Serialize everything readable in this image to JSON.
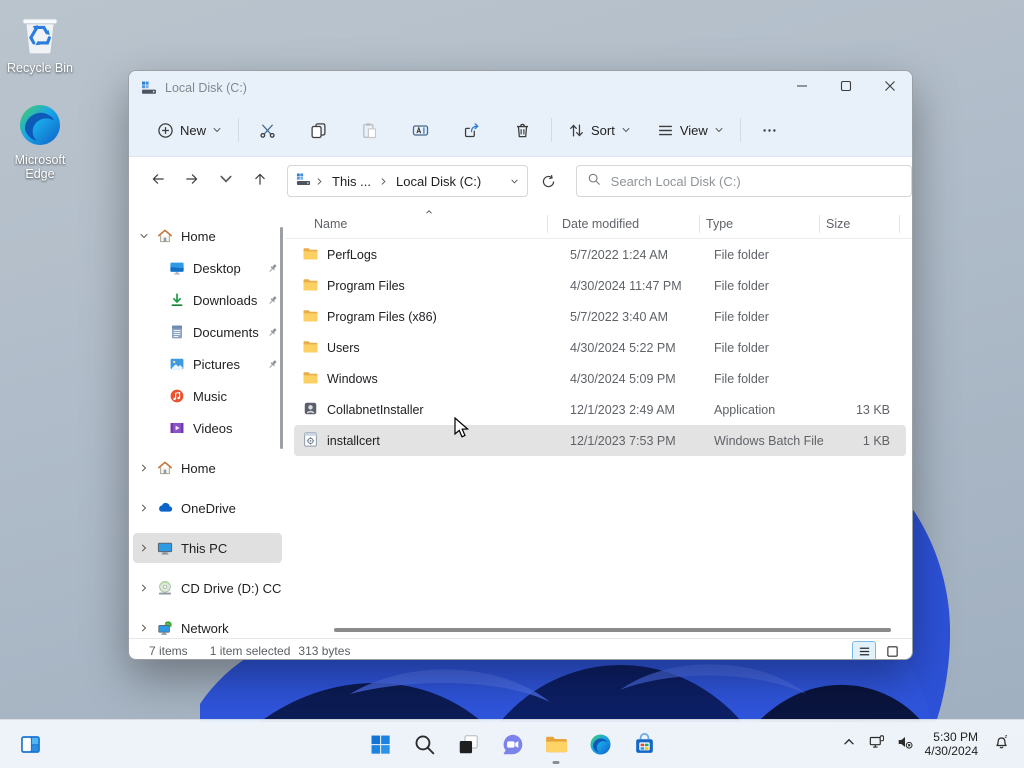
{
  "desktop": {
    "icons": [
      {
        "name": "recycle-bin",
        "icon": "recycle-bin-icon",
        "label": "Recycle Bin"
      },
      {
        "name": "microsoft-edge",
        "icon": "edge-icon",
        "label": "Microsoft Edge"
      }
    ]
  },
  "window": {
    "title": "Local Disk (C:)",
    "title_icon": "drive-icon",
    "controls": [
      {
        "name": "minimize-button",
        "icon": "minimize-icon"
      },
      {
        "name": "maximize-button",
        "icon": "maximize-icon"
      },
      {
        "name": "close-button",
        "icon": "close-icon"
      }
    ],
    "toolbar": {
      "new_label": "New",
      "buttons": [
        {
          "name": "cut-button",
          "icon": "cut-icon"
        },
        {
          "name": "copy-button",
          "icon": "copy-icon"
        },
        {
          "name": "paste-button",
          "icon": "paste-icon"
        },
        {
          "name": "rename-button",
          "icon": "rename-icon"
        },
        {
          "name": "share-button",
          "icon": "share-icon"
        },
        {
          "name": "delete-button",
          "icon": "delete-icon"
        }
      ],
      "sort_label": "Sort",
      "view_label": "View"
    },
    "nav": [
      {
        "name": "back-button",
        "icon": "back-icon"
      },
      {
        "name": "forward-button",
        "icon": "forward-icon"
      },
      {
        "name": "recent-locations-button",
        "icon": "chevron-down-icon"
      },
      {
        "name": "up-button",
        "icon": "up-icon"
      }
    ],
    "addressbar": {
      "icon": "drive-icon",
      "crumbs": [
        "This ...",
        "Local Disk (C:)"
      ]
    },
    "search": {
      "placeholder": "Search Local Disk (C:)"
    },
    "sidebar": [
      {
        "label": "Home",
        "icon": "home-icon",
        "chevron": "down",
        "indent": 0
      },
      {
        "label": "Desktop",
        "icon": "desktop-icon",
        "indent": 1,
        "pinned": true
      },
      {
        "label": "Downloads",
        "icon": "downloads-icon",
        "indent": 1,
        "pinned": true
      },
      {
        "label": "Documents",
        "icon": "documents-icon",
        "indent": 1,
        "pinned": true
      },
      {
        "label": "Pictures",
        "icon": "pictures-icon",
        "indent": 1,
        "pinned": true
      },
      {
        "label": "Music",
        "icon": "music-icon",
        "indent": 1
      },
      {
        "label": "Videos",
        "icon": "videos-icon",
        "indent": 1
      },
      {
        "label": "Home",
        "icon": "home-icon",
        "chevron": "right",
        "indent": 0,
        "gap": true
      },
      {
        "label": "OneDrive",
        "icon": "onedrive-icon",
        "chevron": "right",
        "indent": 0,
        "gap": true
      },
      {
        "label": "This PC",
        "icon": "this-pc-icon",
        "chevron": "right",
        "indent": 0,
        "gap": true,
        "selected": true
      },
      {
        "label": "CD Drive (D:) CC",
        "icon": "cd-drive-icon",
        "chevron": "right",
        "indent": 0,
        "gap": true
      },
      {
        "label": "Network",
        "icon": "network-places-icon",
        "chevron": "right",
        "indent": 0,
        "gap": true
      }
    ],
    "files": {
      "columns": [
        "Name",
        "Date modified",
        "Type",
        "Size"
      ],
      "sort_indicator": "ascending",
      "rows": [
        {
          "name": "PerfLogs",
          "icon": "folder-icon",
          "date": "5/7/2022 1:24 AM",
          "type": "File folder",
          "size": ""
        },
        {
          "name": "Program Files",
          "icon": "folder-icon",
          "date": "4/30/2024 11:47 PM",
          "type": "File folder",
          "size": ""
        },
        {
          "name": "Program Files (x86)",
          "icon": "folder-icon",
          "date": "5/7/2022 3:40 AM",
          "type": "File folder",
          "size": ""
        },
        {
          "name": "Users",
          "icon": "folder-icon",
          "date": "4/30/2024 5:22 PM",
          "type": "File folder",
          "size": ""
        },
        {
          "name": "Windows",
          "icon": "folder-icon",
          "date": "4/30/2024 5:09 PM",
          "type": "File folder",
          "size": ""
        },
        {
          "name": "CollabnetInstaller",
          "icon": "application-icon",
          "date": "12/1/2023 2:49 AM",
          "type": "Application",
          "size": "13 KB"
        },
        {
          "name": "installcert",
          "icon": "batch-file-icon",
          "date": "12/1/2023 7:53 PM",
          "type": "Windows Batch File",
          "size": "1 KB",
          "selected": true
        }
      ]
    },
    "statusbar": {
      "items_count": "7 items",
      "selection": "1 item selected",
      "selection_size": "313 bytes"
    }
  },
  "taskbar": {
    "widgets": {
      "name": "widgets-button",
      "icon": "widgets-icon"
    },
    "center": [
      {
        "name": "start-button",
        "icon": "start-icon"
      },
      {
        "name": "search-button",
        "icon": "search-taskbar-icon"
      },
      {
        "name": "task-view-button",
        "icon": "task-view-icon"
      },
      {
        "name": "chat-button",
        "icon": "chat-icon"
      },
      {
        "name": "file-explorer-button",
        "icon": "file-explorer-icon",
        "active": true
      },
      {
        "name": "edge-button",
        "icon": "edge-icon"
      },
      {
        "name": "store-button",
        "icon": "store-icon"
      }
    ],
    "tray": {
      "icons": [
        {
          "name": "tray-chevron-up",
          "icon": "chevron-up-icon"
        },
        {
          "name": "tray-network",
          "icon": "network-tray-icon"
        },
        {
          "name": "tray-volume-muted",
          "icon": "volume-muted-icon"
        }
      ],
      "time": "5:30 PM",
      "date": "4/30/2024",
      "bell_icon": "notification-bell-icon"
    }
  },
  "colors": {
    "accent_blue": "#2b7cd3",
    "chrome": "#e8f0f9",
    "selection_gray": "#e3e3e3",
    "bloom_blue": "#2d52d8",
    "bloom_dark": "#0c1c55"
  }
}
